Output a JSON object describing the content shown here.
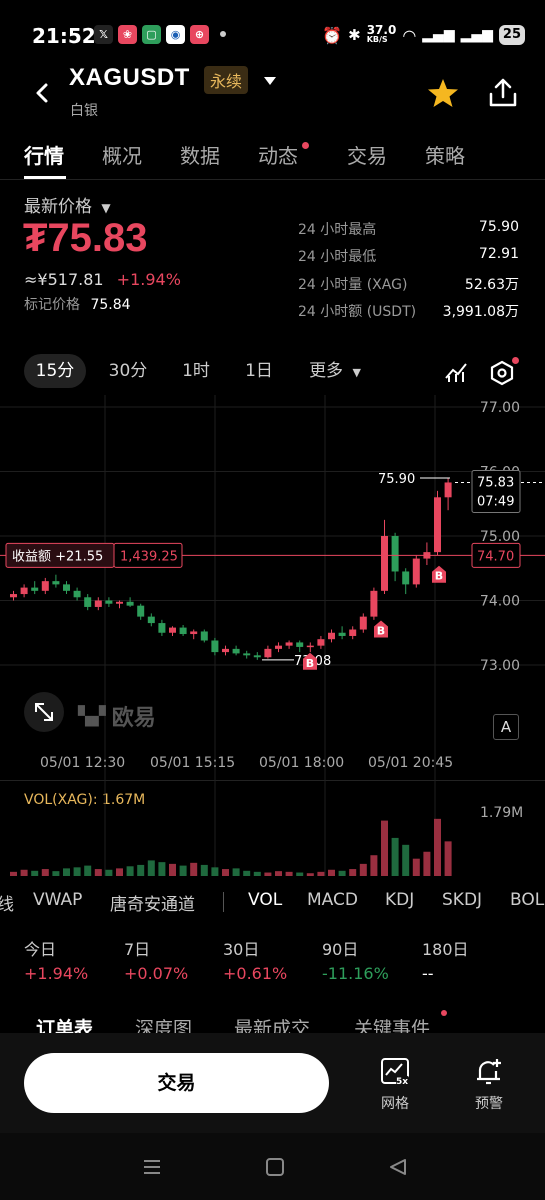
{
  "status_bar": {
    "time": "21:52",
    "net_speed_value": "37.0",
    "net_speed_unit": "KB/S",
    "battery": "25"
  },
  "header": {
    "symbol": "XAGUSDT",
    "contract_type": "永续",
    "subtitle": "白银"
  },
  "tabs": [
    {
      "label": "行情",
      "active": true
    },
    {
      "label": "概况"
    },
    {
      "label": "数据"
    },
    {
      "label": "动态",
      "dot": true
    },
    {
      "label": "交易"
    },
    {
      "label": "策略"
    }
  ],
  "price": {
    "label": "最新价格",
    "last": "₮75.83",
    "cny": "≈¥517.81",
    "change": "+1.94%",
    "mark_label": "标记价格",
    "mark_value": "75.84"
  },
  "stats": [
    {
      "label": "24 小时最高",
      "value": "75.90"
    },
    {
      "label": "24 小时最低",
      "value": "72.91"
    },
    {
      "label": "24 小时量 (XAG)",
      "value": "52.63万"
    },
    {
      "label": "24 小时额 (USDT)",
      "value": "3,991.08万"
    }
  ],
  "periods": [
    "15分",
    "30分",
    "1时",
    "1日",
    "更多"
  ],
  "chart": {
    "position_label": "收益额 +21.55",
    "position_value": "1,439.25",
    "position_price": "74.70",
    "current_price": "75.83",
    "countdown": "07:49",
    "high_label": "75.90",
    "low_label": "73.08",
    "watermark": "欧易",
    "auto_label": "A",
    "buy_marker": "B",
    "time_labels": [
      "05/01 12:30",
      "05/01 15:15",
      "05/01 18:00",
      "05/01 20:45"
    ],
    "vol_label": "VOL(XAG): 1.67M",
    "vol_max": "1.79M",
    "colors": {
      "up": "#e8475f",
      "down": "#2e9e5b",
      "accent": "#e8b85c"
    }
  },
  "chart_data": {
    "type": "candlestick",
    "ylim": [
      72.7,
      77.2
    ],
    "yticks": [
      77.0,
      76.0,
      75.0,
      74.0,
      73.0
    ],
    "ytick_labels": [
      "77.00",
      "76.00",
      "75.00",
      "74.00",
      "73.00"
    ],
    "candles": [
      [
        74.05,
        74.15,
        74.0,
        74.1
      ],
      [
        74.1,
        74.25,
        74.05,
        74.2
      ],
      [
        74.2,
        74.3,
        74.1,
        74.15
      ],
      [
        74.15,
        74.35,
        74.1,
        74.3
      ],
      [
        74.3,
        74.4,
        74.2,
        74.25
      ],
      [
        74.25,
        74.3,
        74.1,
        74.15
      ],
      [
        74.15,
        74.2,
        74.0,
        74.05
      ],
      [
        74.05,
        74.1,
        73.85,
        73.9
      ],
      [
        73.9,
        74.05,
        73.85,
        74.0
      ],
      [
        74.0,
        74.05,
        73.9,
        73.95
      ],
      [
        73.95,
        74.0,
        73.88,
        73.98
      ],
      [
        73.98,
        74.05,
        73.9,
        73.92
      ],
      [
        73.92,
        73.95,
        73.7,
        73.75
      ],
      [
        73.75,
        73.8,
        73.6,
        73.65
      ],
      [
        73.65,
        73.7,
        73.45,
        73.5
      ],
      [
        73.5,
        73.6,
        73.45,
        73.58
      ],
      [
        73.58,
        73.62,
        73.45,
        73.48
      ],
      [
        73.48,
        73.55,
        73.4,
        73.52
      ],
      [
        73.52,
        73.55,
        73.35,
        73.38
      ],
      [
        73.38,
        73.42,
        73.15,
        73.2
      ],
      [
        73.2,
        73.3,
        73.15,
        73.25
      ],
      [
        73.25,
        73.3,
        73.15,
        73.18
      ],
      [
        73.18,
        73.22,
        73.1,
        73.15
      ],
      [
        73.15,
        73.2,
        73.08,
        73.12
      ],
      [
        73.12,
        73.3,
        73.1,
        73.25
      ],
      [
        73.25,
        73.35,
        73.2,
        73.3
      ],
      [
        73.3,
        73.38,
        73.25,
        73.35
      ],
      [
        73.35,
        73.38,
        73.2,
        73.28
      ],
      [
        73.28,
        73.35,
        73.2,
        73.3
      ],
      [
        73.3,
        73.45,
        73.25,
        73.4
      ],
      [
        73.4,
        73.55,
        73.35,
        73.5
      ],
      [
        73.5,
        73.6,
        73.4,
        73.45
      ],
      [
        73.45,
        73.6,
        73.4,
        73.55
      ],
      [
        73.55,
        73.8,
        73.5,
        73.75
      ],
      [
        73.75,
        74.2,
        73.7,
        74.15
      ],
      [
        74.15,
        75.25,
        74.1,
        75.0
      ],
      [
        75.0,
        75.05,
        74.3,
        74.45
      ],
      [
        74.45,
        74.5,
        74.1,
        74.25
      ],
      [
        74.25,
        74.7,
        74.2,
        74.65
      ],
      [
        74.65,
        74.9,
        74.55,
        74.75
      ],
      [
        74.75,
        75.7,
        74.7,
        75.6
      ],
      [
        75.6,
        75.9,
        75.4,
        75.83
      ]
    ],
    "volume": [
      0.12,
      0.18,
      0.15,
      0.2,
      0.14,
      0.22,
      0.25,
      0.3,
      0.2,
      0.18,
      0.22,
      0.28,
      0.32,
      0.45,
      0.4,
      0.35,
      0.3,
      0.38,
      0.32,
      0.25,
      0.2,
      0.22,
      0.15,
      0.12,
      0.1,
      0.14,
      0.12,
      0.1,
      0.08,
      0.12,
      0.18,
      0.15,
      0.2,
      0.35,
      0.6,
      1.6,
      1.1,
      0.9,
      0.5,
      0.7,
      1.65,
      1.0
    ]
  },
  "indicators": [
    "线",
    "VWAP",
    "唐奇安通道",
    "VOL",
    "MACD",
    "KDJ",
    "SKDJ",
    "BOLL"
  ],
  "performance": [
    {
      "label": "今日",
      "value": "+1.94%",
      "color": "#e8475f"
    },
    {
      "label": "7日",
      "value": "+0.07%",
      "color": "#e8475f"
    },
    {
      "label": "30日",
      "value": "+0.61%",
      "color": "#e8475f"
    },
    {
      "label": "90日",
      "value": "-11.16%",
      "color": "#2e9e5b"
    },
    {
      "label": "180日",
      "value": "--",
      "color": "#ffffff"
    }
  ],
  "bottom_tabs": [
    "订单表",
    "深度图",
    "最新成交",
    "关键事件"
  ],
  "action_bar": {
    "trade": "交易",
    "grid": "网格",
    "grid_badge": "5x",
    "alert": "预警"
  }
}
